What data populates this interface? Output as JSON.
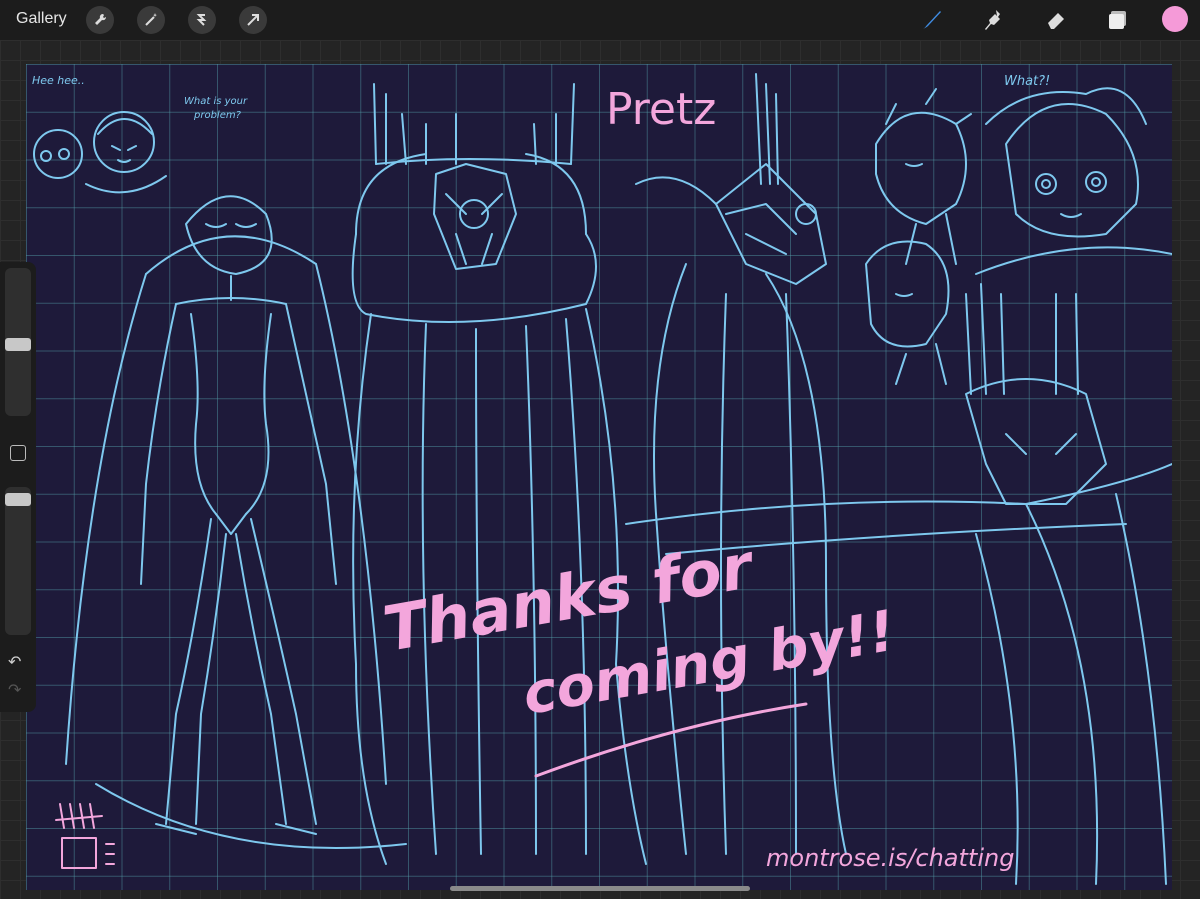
{
  "toolbar": {
    "gallery_label": "Gallery",
    "left_tools": [
      "wrench-icon",
      "magic-wand-icon",
      "selection-icon",
      "transform-arrow-icon"
    ],
    "right_tools": [
      "brush-icon",
      "smudge-icon",
      "eraser-icon",
      "layers-icon"
    ],
    "current_color": "#f59ad8",
    "active_tool_color": "#3f8be0"
  },
  "sidebar": {
    "brush_size_level": 0.48,
    "opacity_level": 0.09
  },
  "canvas": {
    "background": "#1e1a3a",
    "grid_color": "#54a0aa",
    "sketch_color": "#7ec8ee",
    "text_color": "#f3a6dc",
    "annotations": {
      "hee_hee": "Hee hee..",
      "what_is_problem_1": "What is your",
      "what_is_problem_2": "problem?",
      "what": "What?!",
      "title": "Pretz",
      "thanks_1": "Thanks for",
      "thanks_2": "coming by!!",
      "signature_link": "montrose.is/chatting"
    }
  }
}
